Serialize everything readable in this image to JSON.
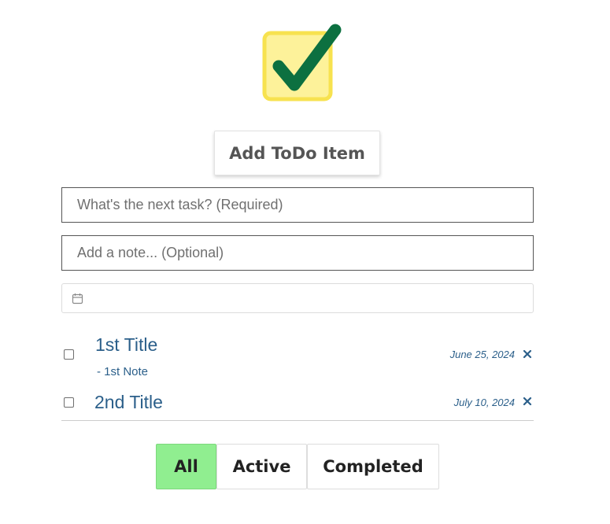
{
  "logo": {
    "icon": "checkmark-logo-icon",
    "box_color": "#fdf29a",
    "box_border": "#f7e24f",
    "check_color": "#0c7040"
  },
  "add_button": {
    "label": "Add ToDo Item"
  },
  "form": {
    "task_placeholder": "What's the next task? (Required)",
    "note_placeholder": "Add a note... (Optional)",
    "date_icon": "calendar-icon"
  },
  "todos": [
    {
      "title": "1st Title",
      "note": "- 1st Note",
      "date": "June 25, 2024",
      "completed": false
    },
    {
      "title": "2nd Title",
      "date": "July 10, 2024",
      "completed": false
    }
  ],
  "filters": {
    "all": "All",
    "active": "Active",
    "completed": "Completed",
    "selected": "all",
    "selected_color": "#90ee90"
  },
  "colors": {
    "text_accent": "#2b5f8a"
  }
}
